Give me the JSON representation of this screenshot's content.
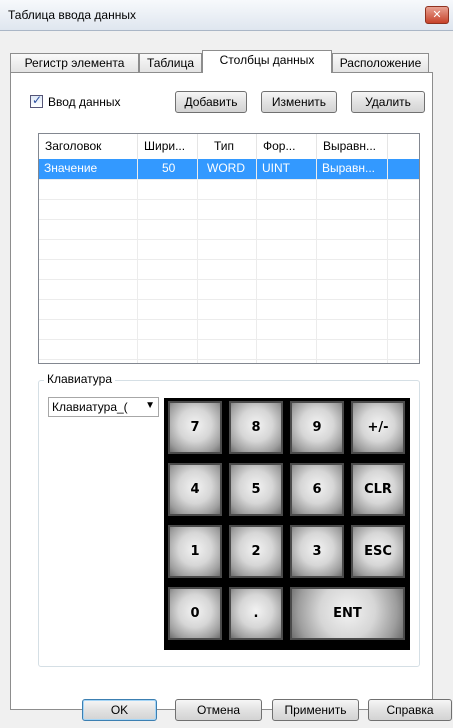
{
  "window": {
    "title": "Таблица ввода данных",
    "close": "✕"
  },
  "tabs": [
    {
      "label": "Регистр элемента"
    },
    {
      "label": "Таблица"
    },
    {
      "label": "Столбцы данных"
    },
    {
      "label": "Расположение"
    }
  ],
  "data_entry": {
    "checkbox_label": "Ввод данных",
    "checked": true,
    "check_mark": "✓",
    "add": "Добавить",
    "edit": "Изменить",
    "delete": "Удалить"
  },
  "grid": {
    "headers": [
      "Заголовок",
      "Шири...",
      "Тип",
      "Фор...",
      "Выравн..."
    ],
    "rows": [
      [
        "Значение",
        "50",
        "WORD",
        "UINT",
        "Выравн..."
      ]
    ]
  },
  "keyboard": {
    "group_label": "Клавиатура",
    "selected": "Клавиатура_(",
    "arrow": "▼",
    "keys": [
      "7",
      "8",
      "9",
      "+/-",
      "4",
      "5",
      "6",
      "CLR",
      "1",
      "2",
      "3",
      "ESC",
      "0",
      ".",
      "ENT"
    ]
  },
  "footer": {
    "ok": "OK",
    "cancel": "Отмена",
    "apply": "Применить",
    "help": "Справка"
  },
  "colors": {
    "selection": "#3399ff",
    "keypad_bg": "#000000"
  }
}
